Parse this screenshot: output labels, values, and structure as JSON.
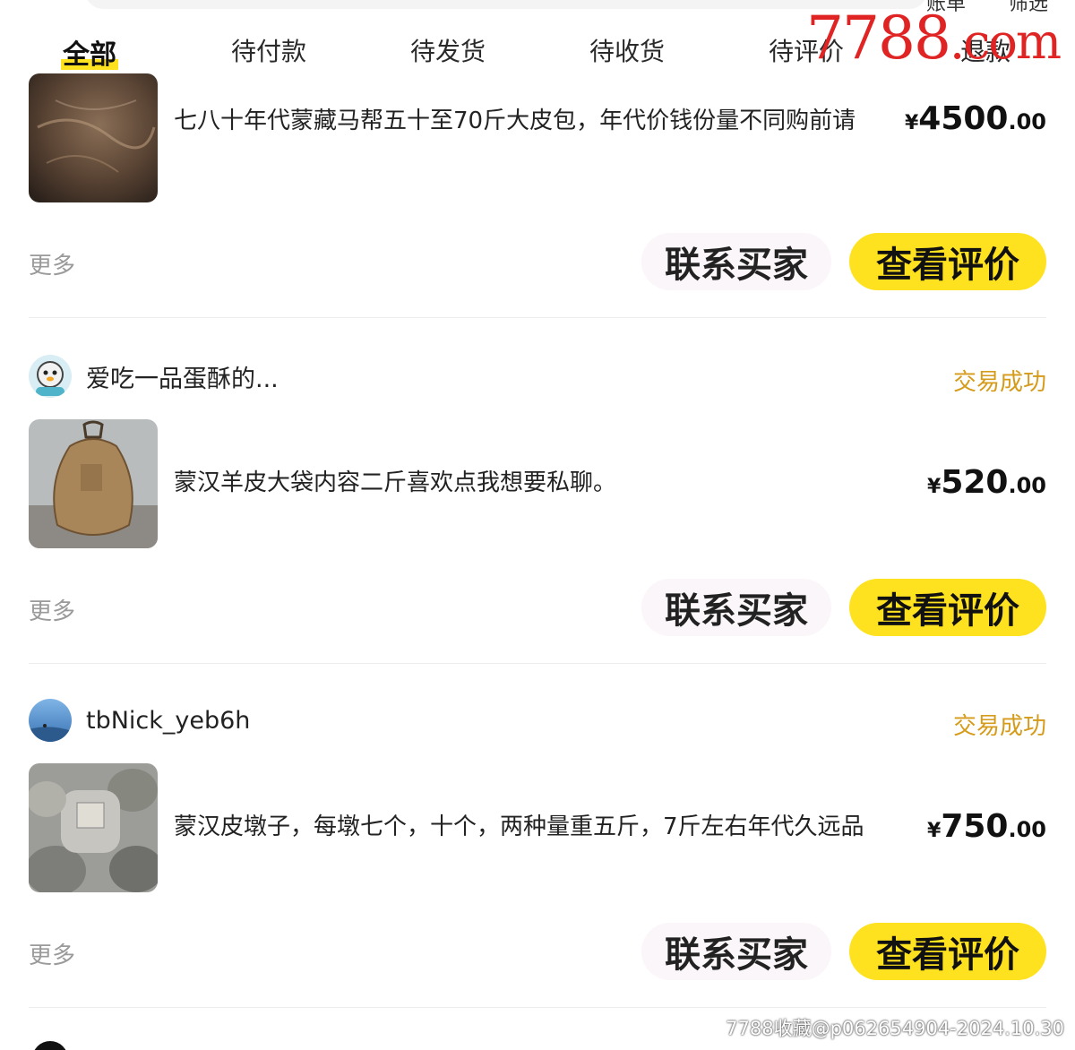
{
  "top_bar": {
    "label_a": "账单",
    "label_b": "筛选"
  },
  "tabs": [
    {
      "label": "全部",
      "active": true
    },
    {
      "label": "待付款",
      "active": false
    },
    {
      "label": "待发货",
      "active": false
    },
    {
      "label": "待收货",
      "active": false
    },
    {
      "label": "待评价",
      "active": false
    },
    {
      "label": "退款",
      "active": false
    }
  ],
  "watermark": {
    "brand": "7788",
    "brand_suffix": ".com",
    "footer": "7788收藏@p062654904-2024.10.30"
  },
  "orders": [
    {
      "seller": "",
      "status": "",
      "title": "七八十年代蒙藏马帮五十至70斤大皮包，年代价钱份量不同购前请",
      "price_symbol": "¥",
      "price_int": "4500",
      "price_dec": ".00",
      "more": "更多",
      "contact": "联系买家",
      "review": "查看评价"
    },
    {
      "seller": "爱吃一品蛋酥的...",
      "status": "交易成功",
      "title": "蒙汉羊皮大袋内容二斤喜欢点我想要私聊。",
      "price_symbol": "¥",
      "price_int": "520",
      "price_dec": ".00",
      "more": "更多",
      "contact": "联系买家",
      "review": "查看评价"
    },
    {
      "seller": "tbNick_yeb6h",
      "status": "交易成功",
      "title": "蒙汉皮墩子，每墩七个，十个，两种量重五斤，7斤左右年代久远品",
      "price_symbol": "¥",
      "price_int": "750",
      "price_dec": ".00",
      "more": "更多",
      "contact": "联系买家",
      "review": "查看评价"
    }
  ],
  "colors": {
    "accent": "#ffe21f",
    "status": "#d59b1a",
    "watermark": "#e02424"
  }
}
